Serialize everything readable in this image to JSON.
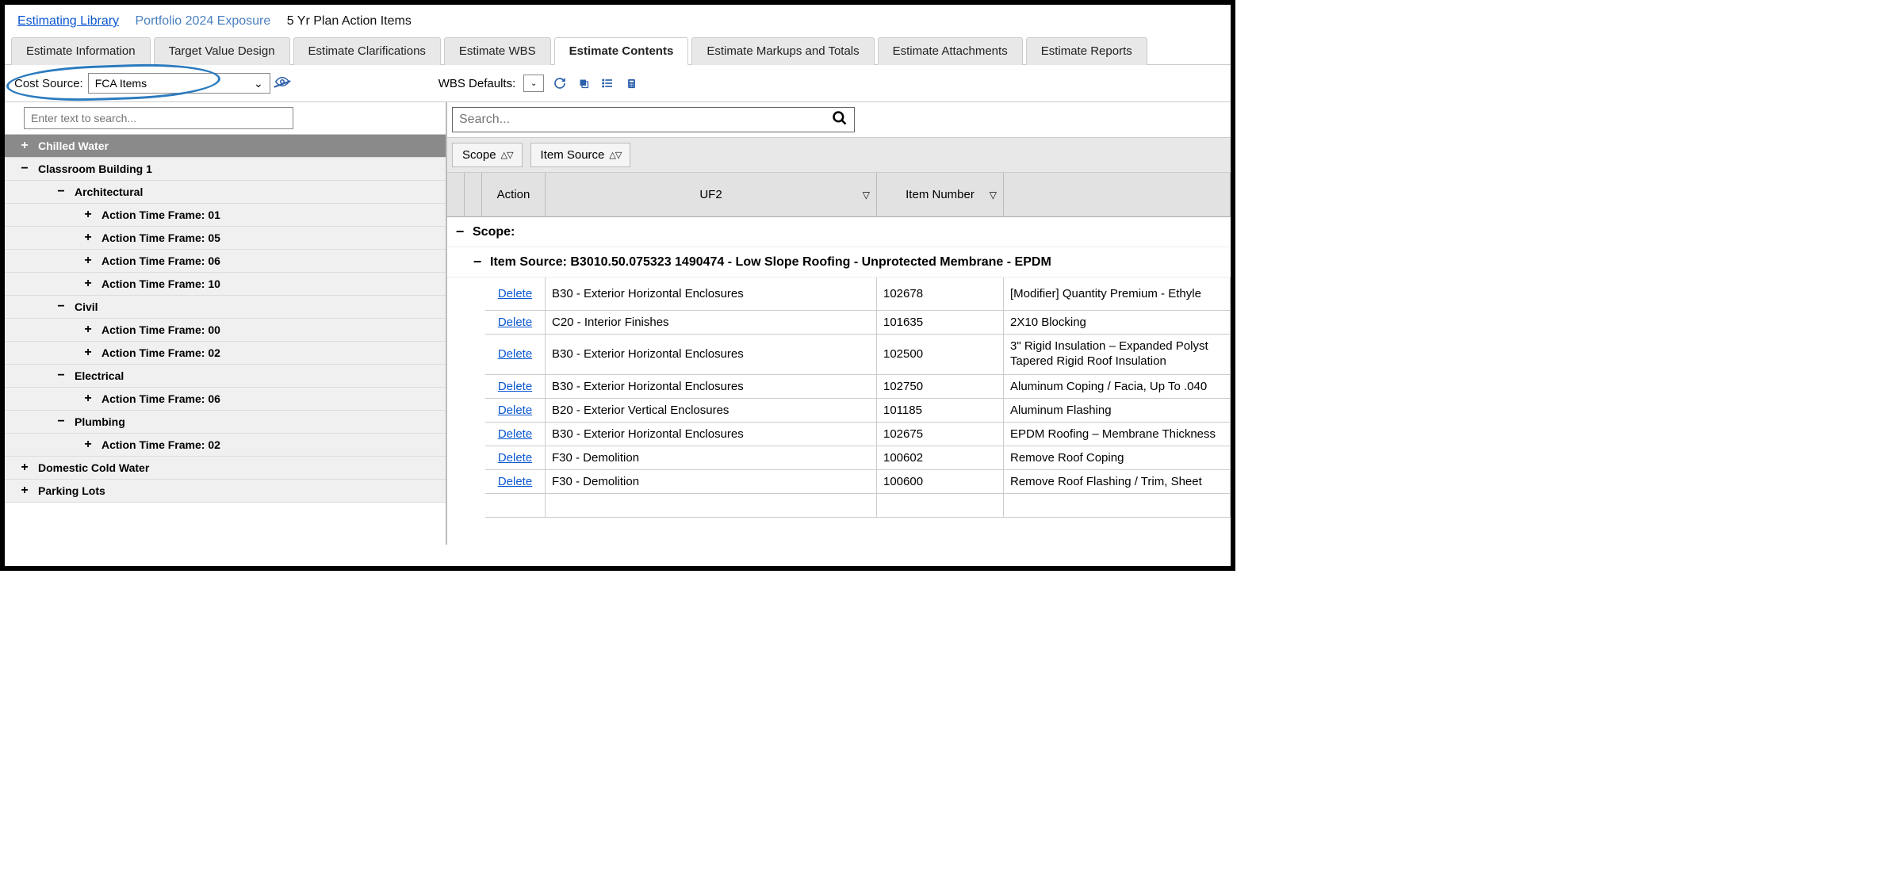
{
  "breadcrumbs": {
    "link1": "Estimating Library",
    "link2": "Portfolio 2024 Exposure",
    "current": "5 Yr Plan Action Items"
  },
  "tabs": [
    "Estimate Information",
    "Target Value Design",
    "Estimate Clarifications",
    "Estimate WBS",
    "Estimate Contents",
    "Estimate Markups and Totals",
    "Estimate Attachments",
    "Estimate Reports"
  ],
  "active_tab_index": 4,
  "toolbar": {
    "cost_source_label": "Cost Source:",
    "cost_source_value": "FCA Items",
    "wbs_defaults_label": "WBS Defaults:"
  },
  "left": {
    "search_placeholder": "Enter text to search...",
    "tree": [
      {
        "level": 0,
        "toggle": "+",
        "label": "Chilled Water",
        "header": true
      },
      {
        "level": 0,
        "toggle": "−",
        "label": "Classroom Building 1"
      },
      {
        "level": 1,
        "toggle": "−",
        "label": "Architectural"
      },
      {
        "level": 2,
        "toggle": "+",
        "label": "Action Time Frame: 01"
      },
      {
        "level": 2,
        "toggle": "+",
        "label": "Action Time Frame: 05"
      },
      {
        "level": 2,
        "toggle": "+",
        "label": "Action Time Frame: 06"
      },
      {
        "level": 2,
        "toggle": "+",
        "label": "Action Time Frame: 10"
      },
      {
        "level": 1,
        "toggle": "−",
        "label": "Civil"
      },
      {
        "level": 2,
        "toggle": "+",
        "label": "Action Time Frame: 00"
      },
      {
        "level": 2,
        "toggle": "+",
        "label": "Action Time Frame: 02"
      },
      {
        "level": 1,
        "toggle": "−",
        "label": "Electrical"
      },
      {
        "level": 2,
        "toggle": "+",
        "label": "Action Time Frame: 06"
      },
      {
        "level": 1,
        "toggle": "−",
        "label": "Plumbing"
      },
      {
        "level": 2,
        "toggle": "+",
        "label": "Action Time Frame: 02"
      },
      {
        "level": 0,
        "toggle": "+",
        "label": "Domestic Cold Water"
      },
      {
        "level": 0,
        "toggle": "+",
        "label": "Parking Lots"
      }
    ]
  },
  "right": {
    "search_placeholder": "Search...",
    "chips": [
      "Scope",
      "Item Source"
    ],
    "columns": {
      "action": "Action",
      "uf2": "UF2",
      "item_number": "Item Number"
    },
    "group1_label": "Scope:",
    "group2_label": "Item Source: B3010.50.075323 1490474 - Low Slope Roofing - Unprotected Membrane - EPDM",
    "rows": [
      {
        "action": "Delete",
        "uf2": "B30 - Exterior Horizontal Enclosures",
        "num": "102678",
        "desc": "[Modifier] Quantity Premium - Ethyle",
        "tall": true
      },
      {
        "action": "Delete",
        "uf2": "C20 - Interior Finishes",
        "num": "101635",
        "desc": "2X10 Blocking"
      },
      {
        "action": "Delete",
        "uf2": "B30 - Exterior Horizontal Enclosures",
        "num": "102500",
        "desc": "3\" Rigid Insulation – Expanded Polyst\nTapered Rigid Roof Insulation",
        "two_line": true
      },
      {
        "action": "Delete",
        "uf2": "B30 - Exterior Horizontal Enclosures",
        "num": "102750",
        "desc": "Aluminum Coping / Facia, Up To .040"
      },
      {
        "action": "Delete",
        "uf2": "B20 - Exterior Vertical Enclosures",
        "num": "101185",
        "desc": "Aluminum Flashing"
      },
      {
        "action": "Delete",
        "uf2": "B30 - Exterior Horizontal Enclosures",
        "num": "102675",
        "desc": "EPDM Roofing – Membrane Thickness"
      },
      {
        "action": "Delete",
        "uf2": "F30 - Demolition",
        "num": "100602",
        "desc": "Remove Roof Coping"
      },
      {
        "action": "Delete",
        "uf2": "F30 - Demolition",
        "num": "100600",
        "desc": "Remove Roof Flashing / Trim, Sheet "
      }
    ]
  }
}
